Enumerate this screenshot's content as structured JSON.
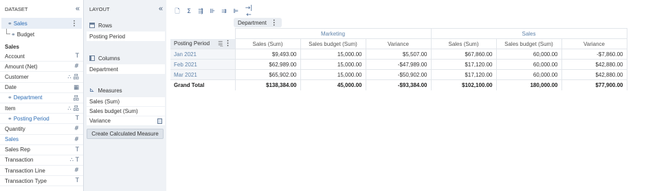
{
  "dataset": {
    "title": "DATASET",
    "collapse": "«",
    "items": [
      {
        "label": "Sales"
      },
      {
        "label": "Budget"
      }
    ],
    "section_title": "Sales",
    "fields": [
      {
        "label": "Account",
        "type_icon": "T"
      },
      {
        "label": "Amount (Net)",
        "type_icon": "#"
      },
      {
        "label": "Customer",
        "type_icon": "∴ 品"
      },
      {
        "label": "Date",
        "type_icon": "▦"
      },
      {
        "label": "Department",
        "type_icon": "品"
      },
      {
        "label": "Item",
        "type_icon": "∴ 品"
      },
      {
        "label": "Posting Period",
        "type_icon": "T"
      },
      {
        "label": "Quantity",
        "type_icon": "#"
      },
      {
        "label": "Sales",
        "type_icon": "#"
      },
      {
        "label": "Sales Rep",
        "type_icon": "T"
      },
      {
        "label": "Transaction",
        "type_icon": "∴ T"
      },
      {
        "label": "Transaction Line",
        "type_icon": "#"
      },
      {
        "label": "Transaction Type",
        "type_icon": "T"
      }
    ]
  },
  "layout": {
    "title": "LAYOUT",
    "collapse": "«",
    "rows_title": "Rows",
    "rows_item": "Posting Period",
    "columns_title": "Columns",
    "columns_item": "Department",
    "measures_title": "Measures",
    "measures": [
      "Sales  (Sum)",
      "Sales budget  (Sum)",
      "Variance"
    ],
    "calc_button": "Create Calculated Measure"
  },
  "toolbar": {
    "icons": [
      "🗋",
      "Σ",
      "⇶",
      "⊪",
      "⇉",
      "⊫",
      "→|←"
    ]
  },
  "pivot": {
    "column_chip": "Department",
    "row_header": "Posting Period",
    "groups": [
      "Marketing",
      "Sales"
    ],
    "columns": [
      "Sales (Sum)",
      "Sales budget (Sum)",
      "Variance",
      "Sales (Sum)",
      "Sales budget (Sum)",
      "Variance"
    ],
    "rows": [
      {
        "label": "Jan 2021",
        "cells": [
          "$9,493.00",
          "15,000.00",
          "$5,507.00",
          "$67,860.00",
          "60,000.00",
          "-$7,860.00"
        ]
      },
      {
        "label": "Feb 2021",
        "cells": [
          "$62,989.00",
          "15,000.00",
          "-$47,989.00",
          "$17,120.00",
          "60,000.00",
          "$42,880.00"
        ]
      },
      {
        "label": "Mar 2021",
        "cells": [
          "$65,902.00",
          "15,000.00",
          "-$50,902.00",
          "$17,120.00",
          "60,000.00",
          "$42,880.00"
        ]
      }
    ],
    "total": {
      "label": "Grand Total",
      "cells": [
        "$138,384.00",
        "45,000.00",
        "-$93,384.00",
        "$102,100.00",
        "180,000.00",
        "$77,900.00"
      ]
    }
  }
}
